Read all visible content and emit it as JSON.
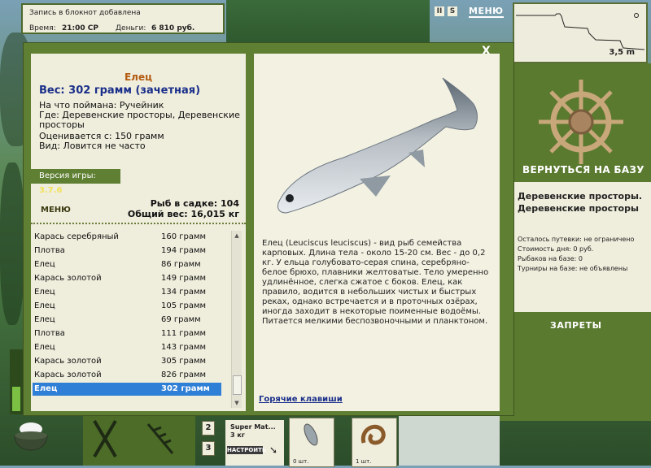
{
  "topbar": {
    "message": "Запись в блокнот добавлена",
    "time_label": "Время:",
    "time_value": "21:00 СР",
    "money_label": "Деньги:",
    "money_value": "6 810 руб."
  },
  "topmenu": {
    "pause_label": "II",
    "save_label": "S",
    "menu_label": "МЕНЮ"
  },
  "depth": {
    "value": "3,5 m"
  },
  "right_panel": {
    "back_label": "ВЕРНУТЬСЯ НА БАЗУ",
    "location": "Деревенские просторы. Деревенские просторы",
    "stat1": "Осталось путевки: не ограничено",
    "stat2": "Стоимость дня: 0 руб.",
    "stat3": "Рыбаков на базе: 0",
    "stat4": "Турниры на базе: не объявлены",
    "bans_label": "ЗАПРЕТЫ"
  },
  "dialog": {
    "close_label": "X",
    "fish_name": "Елец",
    "weight": "Вес: 302 грамм (зачетная)",
    "caught_on": "На что поймана: Ручейник",
    "where_line1": "Где: Деревенские просторы, Деревенские",
    "where_line2": "просторы",
    "valued_from": "Оценивается с: 150 грамм",
    "kind": "Вид: Ловится не часто",
    "version_label": "Версия игры:",
    "version_value": "3.7.6",
    "menu_label": "МЕНЮ",
    "cage_line1": "Рыб в садке: 104",
    "cage_line2": "Общий вес: 16,015 кг",
    "list": [
      {
        "name": "Карась серебряный",
        "weight": "160 грамм"
      },
      {
        "name": "Плотва",
        "weight": "194 грамм"
      },
      {
        "name": "Елец",
        "weight": "86 грамм"
      },
      {
        "name": "Карась золотой",
        "weight": "149 грамм"
      },
      {
        "name": "Елец",
        "weight": "134 грамм"
      },
      {
        "name": "Елец",
        "weight": "105 грамм"
      },
      {
        "name": "Елец",
        "weight": "69 грамм"
      },
      {
        "name": "Плотва",
        "weight": "111 грамм"
      },
      {
        "name": "Елец",
        "weight": "143 грамм"
      },
      {
        "name": "Карась золотой",
        "weight": "305 грамм"
      },
      {
        "name": "Карась золотой",
        "weight": "826 грамм"
      },
      {
        "name": "Елец",
        "weight": "302 грамм"
      }
    ],
    "description": "Елец (Leuciscus leuciscus) - вид рыб семейства карповых. Длина тела - около 15-20 см. Вес - до 0,2 кг. У ельца голубовато-серая спина, серебряно-белое брюхо, плавники желтоватые. Тело умеренно удлинённое, слегка сжатое с боков. Елец, как правило, водится в небольших чистых и быстрых реках, однако встречается и в проточных озёрах, иногда заходит в некоторые поименные водоёмы. Питается мелкими беспозвоночными и планктоном.",
    "hotkeys_label": "Горячие клавиши"
  },
  "bottom": {
    "num2": "2",
    "num3": "3",
    "rod_title": "Super Mat...",
    "rod_weight": "3 кг",
    "rod_button": "НАСТРОИТЬ",
    "slot1_count": "0 шт.",
    "slot2_count": "1 шт."
  },
  "colors": {
    "panel_green": "#5f7f33",
    "paper": "#efeddc",
    "fish_name": "#b35a10",
    "weight_blue": "#1a2f8a",
    "selection": "#2f7fd6"
  }
}
